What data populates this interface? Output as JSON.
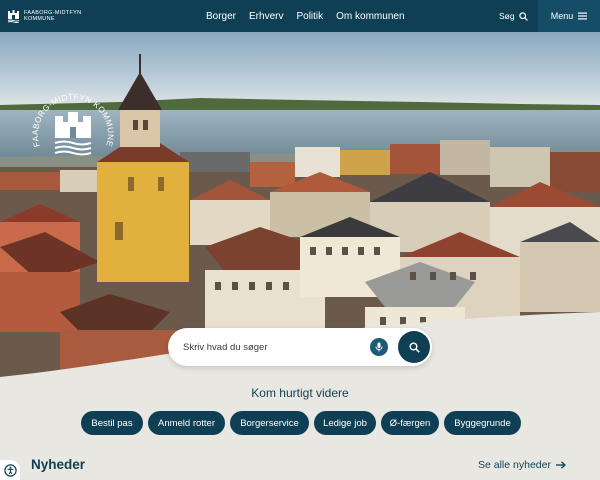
{
  "header": {
    "brand_line1": "FAABORG-MIDTFYN",
    "brand_line2": "KOMMUNE",
    "nav": [
      "Borger",
      "Erhverv",
      "Politik",
      "Om kommunen"
    ],
    "search_label": "Søg",
    "menu_label": "Menu"
  },
  "hero": {
    "seal_text": "FAABORG-MIDTFYN KOMMUNE"
  },
  "search": {
    "placeholder": "Skriv hvad du søger"
  },
  "quick_links": {
    "title": "Kom hurtigt videre",
    "items": [
      "Bestil pas",
      "Anmeld rotter",
      "Borgerservice",
      "Ledige job",
      "Ø-færgen",
      "Byggegrunde"
    ]
  },
  "news": {
    "title": "Nyheder",
    "see_all": "Se alle nyheder"
  },
  "colors": {
    "primary": "#0f3f55",
    "background": "#e9e7e1"
  },
  "icons": [
    "search-icon",
    "menu-icon",
    "microphone-icon",
    "arrow-right-icon",
    "accessibility-icon",
    "coat-of-arms-icon"
  ]
}
